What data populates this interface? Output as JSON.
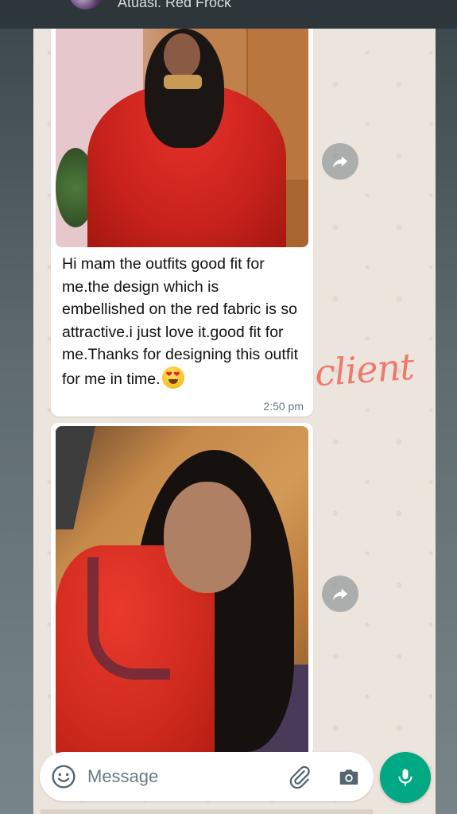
{
  "header": {
    "title": "Atuasi. Red Frock"
  },
  "messages": [
    {
      "type": "image_with_caption",
      "caption_before_emoji": "Hi mam the outfits good fit for me.the design which is embellished on the red fabric is so attractive.i just love it.good fit for me.Thanks for designing this outfit for me in time.",
      "emoji": "heart-eyes-emoji",
      "time": "2:50 pm"
    },
    {
      "type": "image"
    }
  ],
  "overlay": {
    "handwritten_label": "client",
    "label_color": "#ee7a6f"
  },
  "composer": {
    "placeholder": "Message"
  },
  "colors": {
    "accent": "#00a884",
    "chat_background": "#ece5dd",
    "bubble": "#ffffff",
    "timestamp": "#667781"
  },
  "icons": {
    "forward": "forward-arrow-icon",
    "emoji": "smiley-icon",
    "attach": "paperclip-icon",
    "camera": "camera-icon",
    "mic": "microphone-icon"
  }
}
